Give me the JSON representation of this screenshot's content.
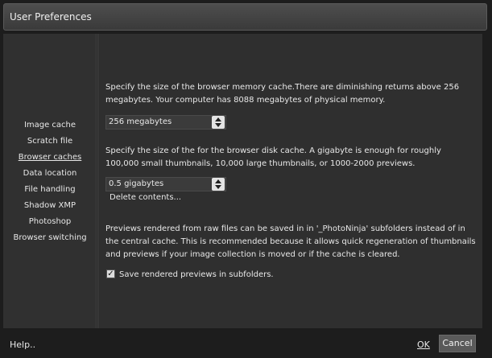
{
  "window": {
    "title": "User Preferences"
  },
  "sidebar": {
    "items": [
      {
        "label": "Image cache"
      },
      {
        "label": "Scratch file"
      },
      {
        "label": "Browser caches"
      },
      {
        "label": "Data location"
      },
      {
        "label": "File handling"
      },
      {
        "label": "Shadow XMP"
      },
      {
        "label": "Photoshop"
      },
      {
        "label": "Browser switching"
      }
    ],
    "selected": "Browser caches"
  },
  "content": {
    "memory_cache_text": "Specify the size of the browser memory cache.There are diminishing returns above 256 megabytes. Your computer has 8088 megabytes of physical memory.",
    "memory_cache_value": "256 megabytes",
    "disk_cache_text": "Specify the size of the for the browser disk cache.  A gigabyte is enough for roughly 100,000 small thumbnails, 10,000 large thumbnails, or 1000-2000 previews.",
    "disk_cache_value": "0.5 gigabytes",
    "delete_contents_label": "Delete contents...",
    "previews_text": "Previews rendered from raw files can be saved in in '_PhotoNinja' subfolders instead of in the central cache. This is recommended because it allows quick regeneration of thumbnails and previews if your image collection is moved or if the cache is cleared.",
    "save_previews_label": "Save rendered previews in subfolders.",
    "save_previews_checked": true
  },
  "footer": {
    "help_label": "Help..",
    "ok_label": "OK",
    "cancel_label": "Cancel"
  }
}
